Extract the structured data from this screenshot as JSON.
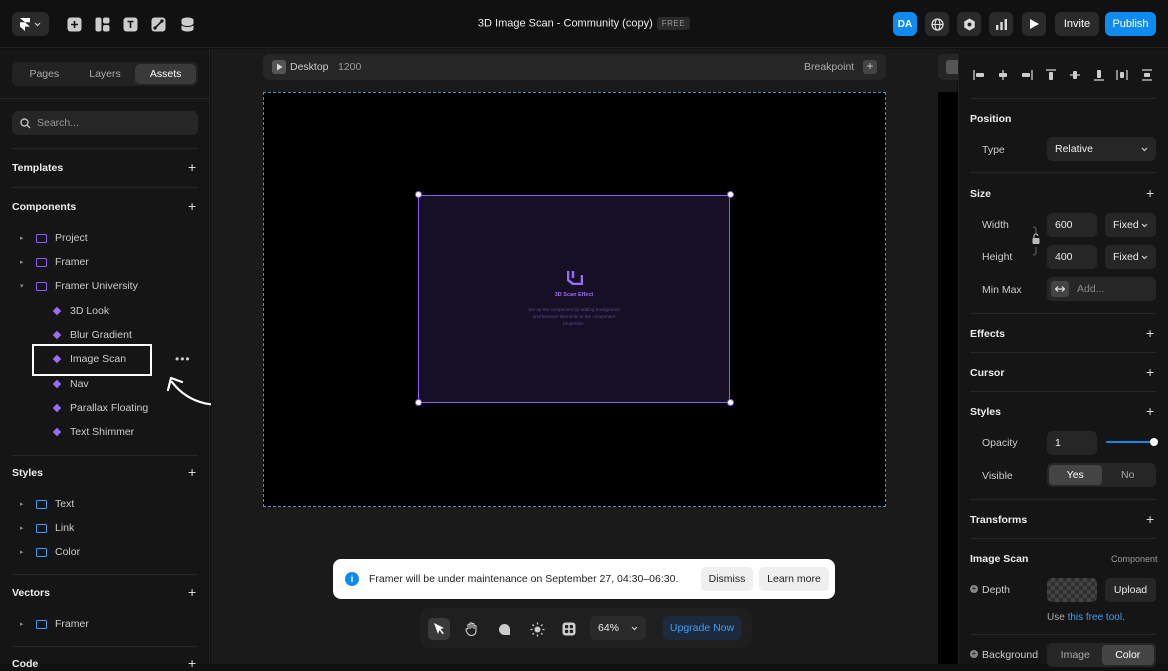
{
  "topbar": {
    "title": "3D Image Scan - Community (copy)",
    "badge": "FREE",
    "avatar": "DA",
    "invite": "Invite",
    "publish": "Publish"
  },
  "left": {
    "tabs": [
      "Pages",
      "Layers",
      "Assets"
    ],
    "active_tab": "Assets",
    "search_placeholder": "Search...",
    "templates": "Templates",
    "components": "Components",
    "component_folders": [
      "Project",
      "Framer",
      "Framer University"
    ],
    "fu_items": [
      "3D Look",
      "Blur Gradient",
      "Image Scan",
      "Nav",
      "Parallax Floating",
      "Text Shimmer"
    ],
    "styles": "Styles",
    "style_items": [
      "Text",
      "Link",
      "Color"
    ],
    "vectors": "Vectors",
    "vector_items": [
      "Framer"
    ],
    "code": "Code",
    "more_menu": "•••"
  },
  "canvas": {
    "frame_name": "Desktop",
    "frame_width": "1200",
    "breakpoint": "Breakpoint",
    "component_title": "3D Scan Effect",
    "component_desc": "Set up the component by adding background and bouncer elements to the component properties."
  },
  "toast": {
    "message": "Framer will be under maintenance on September 27, 04:30–06:30.",
    "dismiss": "Dismiss",
    "learn_more": "Learn more"
  },
  "bottom_toolbar": {
    "zoom": "64%",
    "upgrade": "Upgrade Now"
  },
  "right": {
    "position": "Position",
    "type_label": "Type",
    "type_value": "Relative",
    "size": "Size",
    "width_label": "Width",
    "width_value": "600",
    "width_mode": "Fixed",
    "height_label": "Height",
    "height_value": "400",
    "height_mode": "Fixed",
    "minmax_label": "Min Max",
    "minmax_placeholder": "Add...",
    "effects": "Effects",
    "cursor": "Cursor",
    "styles": "Styles",
    "opacity_label": "Opacity",
    "opacity_value": "1",
    "opacity_level": 1,
    "visible_label": "Visible",
    "visible_yes": "Yes",
    "visible_no": "No",
    "transforms": "Transforms",
    "image_scan": "Image Scan",
    "component_tag": "Component",
    "depth_label": "Depth",
    "upload": "Upload",
    "use_prefix": "Use ",
    "use_link": "this free tool",
    "use_suffix": ".",
    "background_label": "Background",
    "bg_image": "Image",
    "bg_color": "Color"
  },
  "colors": {
    "accent_blue": "#0f8bf0",
    "component_purple": "#8b5cf6",
    "folder_blue": "#3aa0f5"
  }
}
